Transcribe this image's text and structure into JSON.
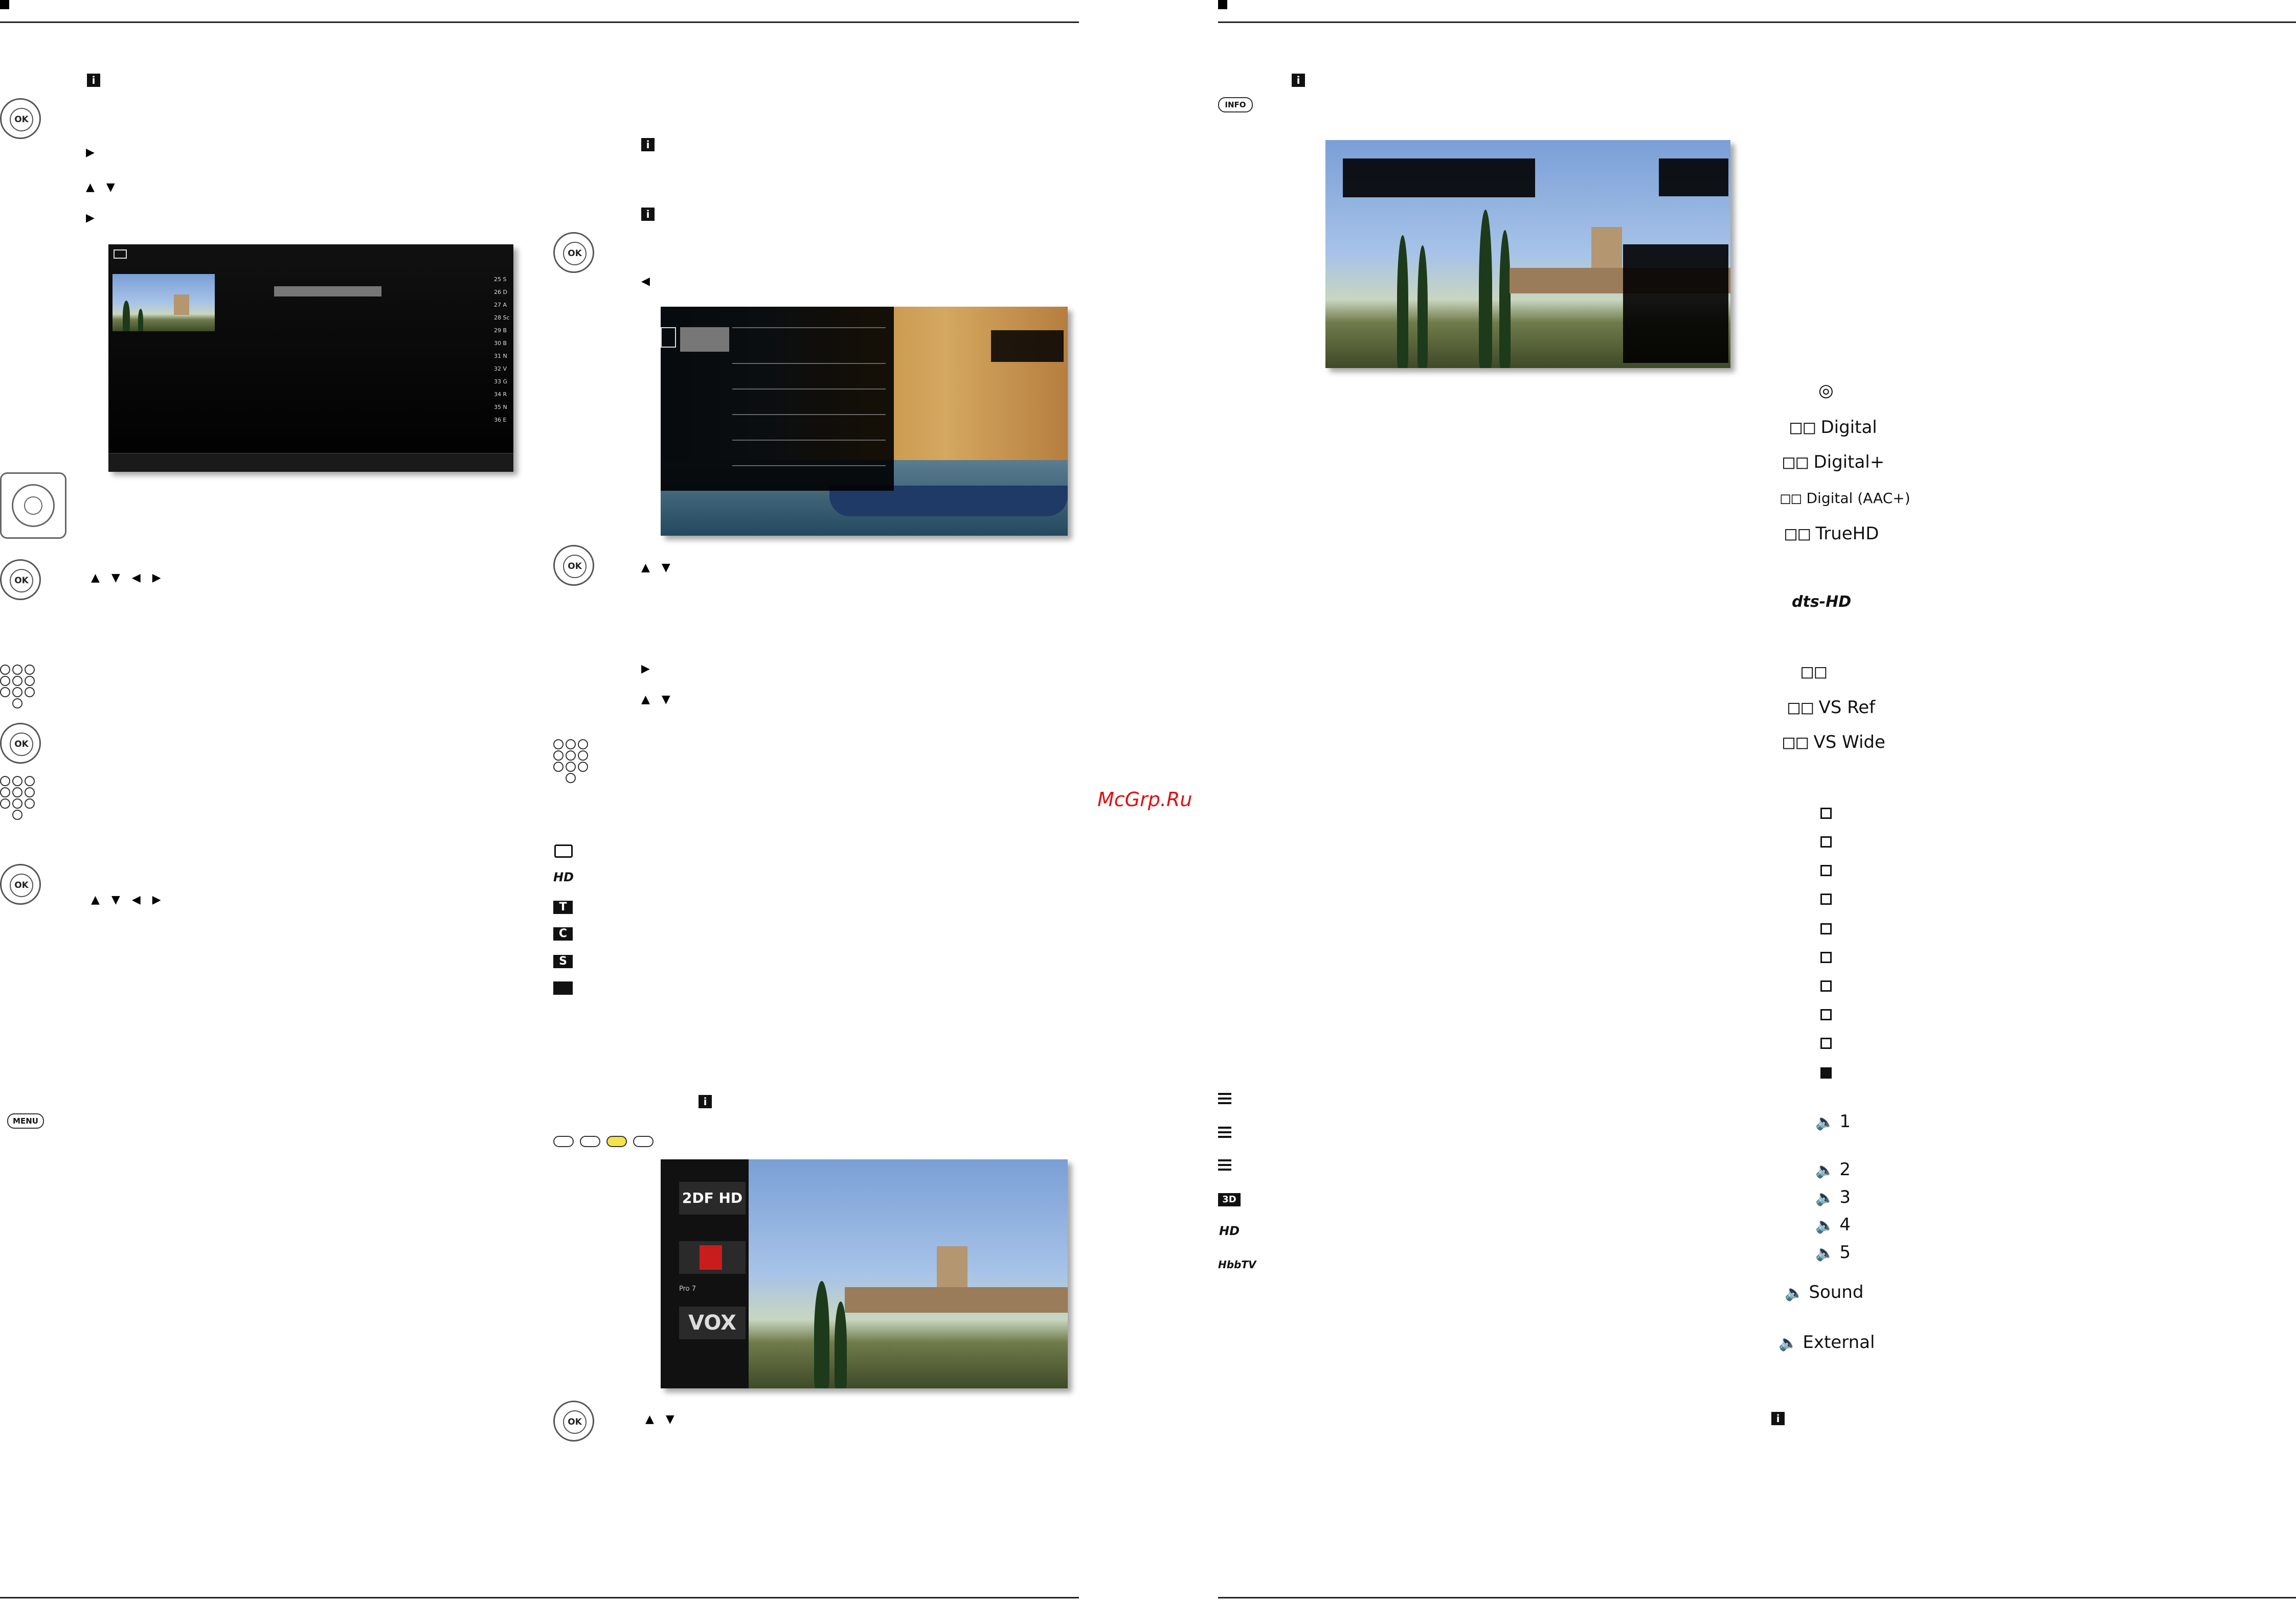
{
  "watermark": "McGrp.Ru",
  "buttons": {
    "ok": "OK",
    "info": "INFO",
    "menu": "MENU",
    "info_i": "i"
  },
  "arrows": {
    "right": "▶",
    "up_down": "▲ ▼",
    "up_down_left_right": "▲ ▼ ◀ ▶",
    "left": "◀"
  },
  "channel_list": {
    "numbers": [
      "25 S",
      "26 D",
      "27 A",
      "28 Sc",
      "29 B",
      "30 B",
      "31 N",
      "32 V",
      "33 G",
      "34 R",
      "35 N",
      "36 E"
    ]
  },
  "channel_logos": {
    "zdf": "2DF HD",
    "pro7_label": "Pro 7",
    "vox": "VOX"
  },
  "sound_formats": {
    "digital": "Digital",
    "digital_plus": "Digital+",
    "digital_aac": "Digital (AAC+)",
    "truehd": "TrueHD",
    "dts": "dts-HD",
    "vs_ref": "VS Ref",
    "vs_wide": "VS Wide",
    "track1": "1",
    "track2": "2",
    "track3": "3",
    "track4": "4",
    "track5": "5",
    "sound": "Sound",
    "external": "External"
  },
  "left_icons": {
    "hd": "HD",
    "t": "T",
    "c": "C",
    "s": "S",
    "threed": "3D",
    "hbbtv": "HbbTV"
  }
}
